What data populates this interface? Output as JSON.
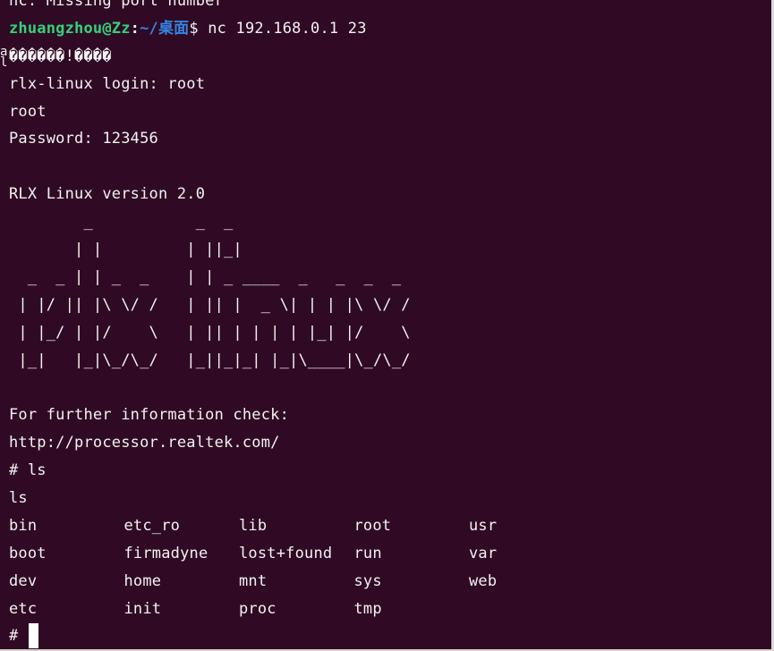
{
  "terminal": {
    "top_line": "nc: Missing port number",
    "prompt": {
      "user_host": "zhuangzhou@Zz",
      "colon": ":",
      "path": "~/桌面",
      "dollar": "$ ",
      "command": "nc 192.168.0.1 23"
    },
    "garbled": "������!����",
    "login_line": "rlx-linux login: root",
    "echo_root": "root",
    "password_line": "Password: 123456",
    "version_line": "RLX Linux version 2.0",
    "ascii_art": [
      "        _           _  _",
      "       | |         | ||_|",
      "  _  _ | | _  _    | | _ ____  _   _  _  _",
      " | |/ || |\\ \\/ /   | || |  _ \\| | | |\\ \\/ /",
      " | |_/ | |/    \\   | || | | | | |_| |/    \\",
      " |_|   |_|\\_/\\_/   |_||_|_| |_|\\____|\\_/\\_/"
    ],
    "info_line": "For further information check:",
    "url_line": "http://processor.realtek.com/",
    "cmd_prompt_ls": "# ls",
    "ls_echo": "ls",
    "ls_rows": [
      [
        "bin",
        "etc_ro",
        "lib",
        "root",
        "usr"
      ],
      [
        "boot",
        "firmadyne",
        "lost+found",
        "run",
        "var"
      ],
      [
        "dev",
        "home",
        "mnt",
        "sys",
        "web"
      ],
      [
        "etc",
        "init",
        "proc",
        "tmp",
        ""
      ]
    ],
    "final_prompt": "#",
    "left_glitch": "a\nl"
  }
}
